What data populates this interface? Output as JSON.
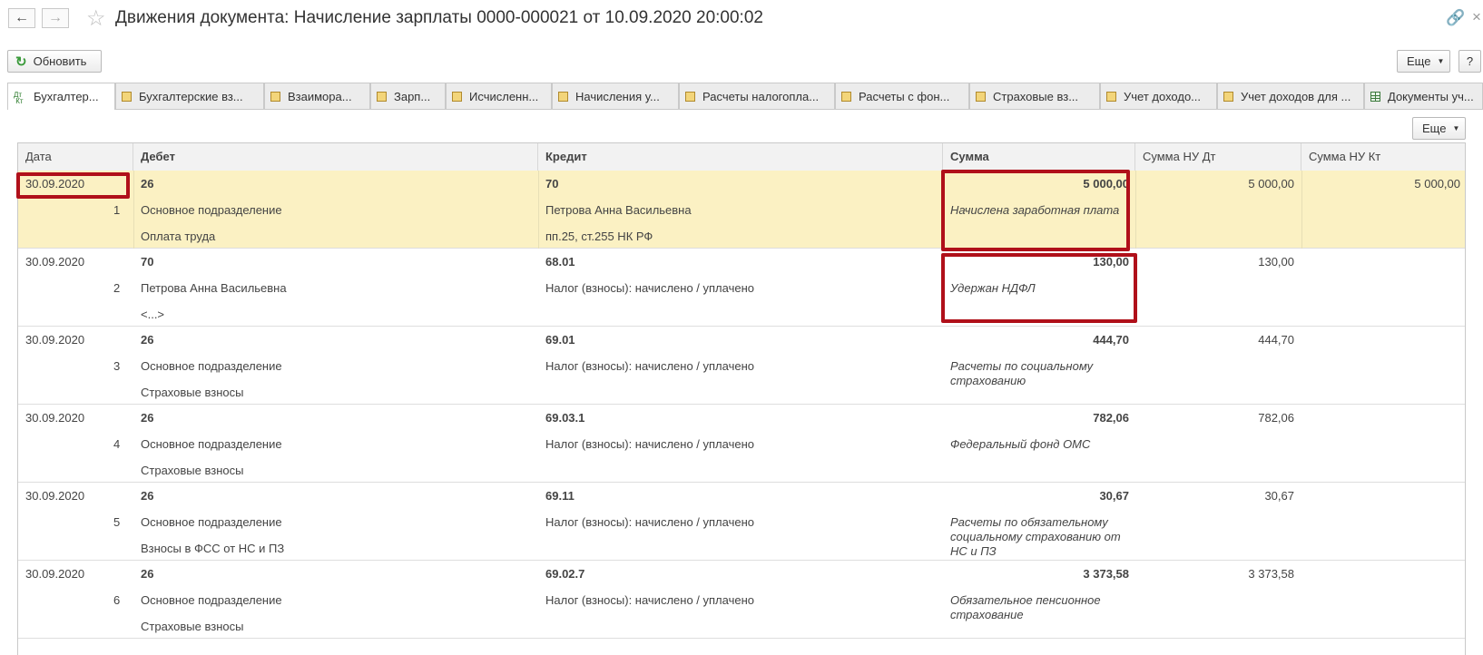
{
  "window": {
    "title": "Движения документа: Начисление зарплаты 0000-000021 от 10.09.2020 20:00:02",
    "back_icon": "arrow-left-icon",
    "forward_icon": "arrow-right-icon",
    "favorite_icon": "star-icon",
    "link_icon": "link-icon",
    "close_icon": "close-icon"
  },
  "toolbar": {
    "refresh_label": "Обновить",
    "more_label": "Еще",
    "help_label": "?",
    "table_more_label": "Еще"
  },
  "tabs": [
    {
      "label": "Бухгалтер...",
      "icon": "dt-kt-icon"
    },
    {
      "label": "Бухгалтерские вз...",
      "icon": "register-icon"
    },
    {
      "label": "Взаимора...",
      "icon": "register-icon"
    },
    {
      "label": "Зарп...",
      "icon": "register-icon"
    },
    {
      "label": "Исчисленн...",
      "icon": "register-icon"
    },
    {
      "label": "Начисления у...",
      "icon": "register-icon"
    },
    {
      "label": "Расчеты налогопла...",
      "icon": "register-icon"
    },
    {
      "label": "Расчеты с фон...",
      "icon": "register-icon"
    },
    {
      "label": "Страховые вз...",
      "icon": "register-icon"
    },
    {
      "label": "Учет доходо...",
      "icon": "register-icon"
    },
    {
      "label": "Учет доходов для ...",
      "icon": "register-icon"
    },
    {
      "label": "Документы уч...",
      "icon": "table-icon"
    }
  ],
  "table": {
    "columns": [
      "Дата",
      "Дебет",
      "Кредит",
      "Сумма",
      "Сумма НУ Дт",
      "Сумма НУ Кт"
    ],
    "rows": [
      {
        "date": "30.09.2020",
        "num": "1",
        "debit": "26",
        "debit_sub1": "Основное подразделение",
        "debit_sub2": "Оплата труда",
        "credit": "70",
        "credit_sub1": "Петрова Анна Васильевна",
        "credit_sub2": "пп.25, ст.255 НК РФ",
        "sum": "5 000,00",
        "content": "Начислена заработная плата",
        "nu_dt": "5 000,00",
        "nu_kt": "5 000,00"
      },
      {
        "date": "30.09.2020",
        "num": "2",
        "debit": "70",
        "debit_sub1": "Петрова Анна Васильевна",
        "debit_sub2": "<...>",
        "credit": "68.01",
        "credit_sub1": "Налог (взносы): начислено / уплачено",
        "credit_sub2": "",
        "sum": "130,00",
        "content": "Удержан НДФЛ",
        "nu_dt": "130,00",
        "nu_kt": ""
      },
      {
        "date": "30.09.2020",
        "num": "3",
        "debit": "26",
        "debit_sub1": "Основное подразделение",
        "debit_sub2": "Страховые взносы",
        "credit": "69.01",
        "credit_sub1": "Налог (взносы): начислено / уплачено",
        "credit_sub2": "",
        "sum": "444,70",
        "content": "Расчеты по социальному страхованию",
        "nu_dt": "444,70",
        "nu_kt": ""
      },
      {
        "date": "30.09.2020",
        "num": "4",
        "debit": "26",
        "debit_sub1": "Основное подразделение",
        "debit_sub2": "Страховые взносы",
        "credit": "69.03.1",
        "credit_sub1": "Налог (взносы): начислено / уплачено",
        "credit_sub2": "",
        "sum": "782,06",
        "content": "Федеральный фонд ОМС",
        "nu_dt": "782,06",
        "nu_kt": ""
      },
      {
        "date": "30.09.2020",
        "num": "5",
        "debit": "26",
        "debit_sub1": "Основное подразделение",
        "debit_sub2": "Взносы в ФСС от НС и ПЗ",
        "credit": "69.11",
        "credit_sub1": "Налог (взносы): начислено / уплачено",
        "credit_sub2": "",
        "sum": "30,67",
        "content": "Расчеты по обязательному социальному страхованию от НС и ПЗ",
        "nu_dt": "30,67",
        "nu_kt": ""
      },
      {
        "date": "30.09.2020",
        "num": "6",
        "debit": "26",
        "debit_sub1": "Основное подразделение",
        "debit_sub2": "Страховые взносы",
        "credit": "69.02.7",
        "credit_sub1": "Налог (взносы): начислено / уплачено",
        "credit_sub2": "",
        "sum": "3 373,58",
        "content": "Обязательное пенсионное страхование",
        "nu_dt": "3 373,58",
        "nu_kt": ""
      }
    ]
  },
  "colors": {
    "selected_row": "#fbf1c3",
    "highlight_frame": "#b0101a",
    "refresh_icon": "#3a9a3a"
  }
}
